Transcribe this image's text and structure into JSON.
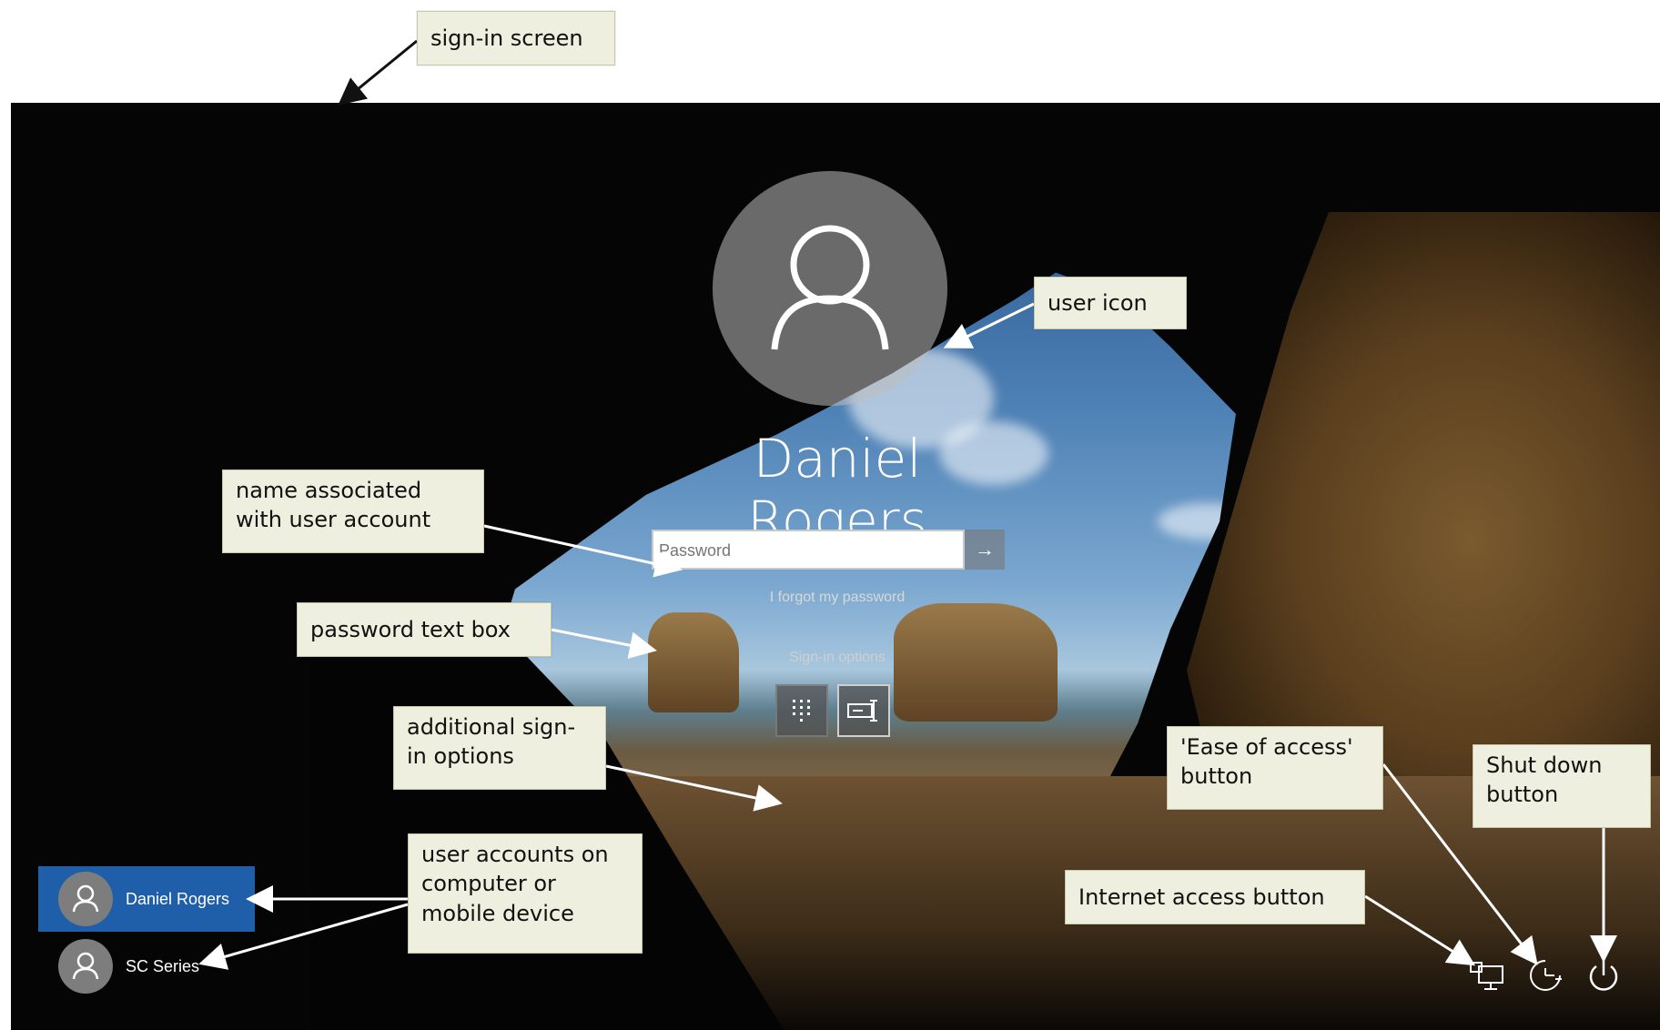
{
  "signin": {
    "user_name": "Daniel Rogers",
    "password_placeholder": "Password",
    "forgot_password": "I forgot my password",
    "signin_options_label": "Sign-in options"
  },
  "accounts": [
    {
      "name": "Daniel Rogers",
      "selected": true
    },
    {
      "name": "SC Series",
      "selected": false
    }
  ],
  "system_icons": [
    "network-icon",
    "ease-of-access-icon",
    "power-icon"
  ],
  "callouts": {
    "signin_screen": "sign-in screen",
    "user_icon": "user icon",
    "name_associated": "name associated with user account",
    "password_text_box": "password text box",
    "additional_options": "additional sign-in options",
    "user_accounts": "user accounts on computer or mobile device",
    "internet_access": "Internet access button",
    "ease_of_access": "'Ease of access' button",
    "shut_down": "Shut down button"
  },
  "colors": {
    "accent": "#1f5ea8",
    "callout_bg": "#efefdf",
    "screen_bg": "#050505"
  }
}
